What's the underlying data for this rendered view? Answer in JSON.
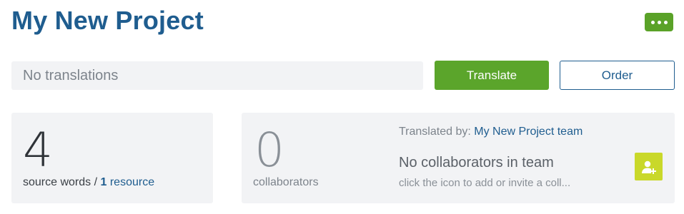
{
  "header": {
    "title": "My New Project",
    "more_icon": "ellipsis-icon"
  },
  "status": {
    "text": "No translations"
  },
  "actions": {
    "translate_label": "Translate",
    "order_label": "Order"
  },
  "words_card": {
    "count": "4",
    "caption_prefix": "source words / ",
    "resource_count": "1",
    "resource_label": "resource"
  },
  "collaborators_card": {
    "count": "0",
    "caption": "collaborators",
    "translated_by_label": "Translated by:",
    "team_name": "My New Project team",
    "empty_title": "No collaborators in team",
    "empty_hint": "click the icon to add or invite a coll...",
    "add_icon": "add-user-icon"
  },
  "colors": {
    "title": "#1f5d8f",
    "primary_green": "#5ba52b",
    "lime": "#c9d82a",
    "card_bg": "#f2f3f5"
  }
}
